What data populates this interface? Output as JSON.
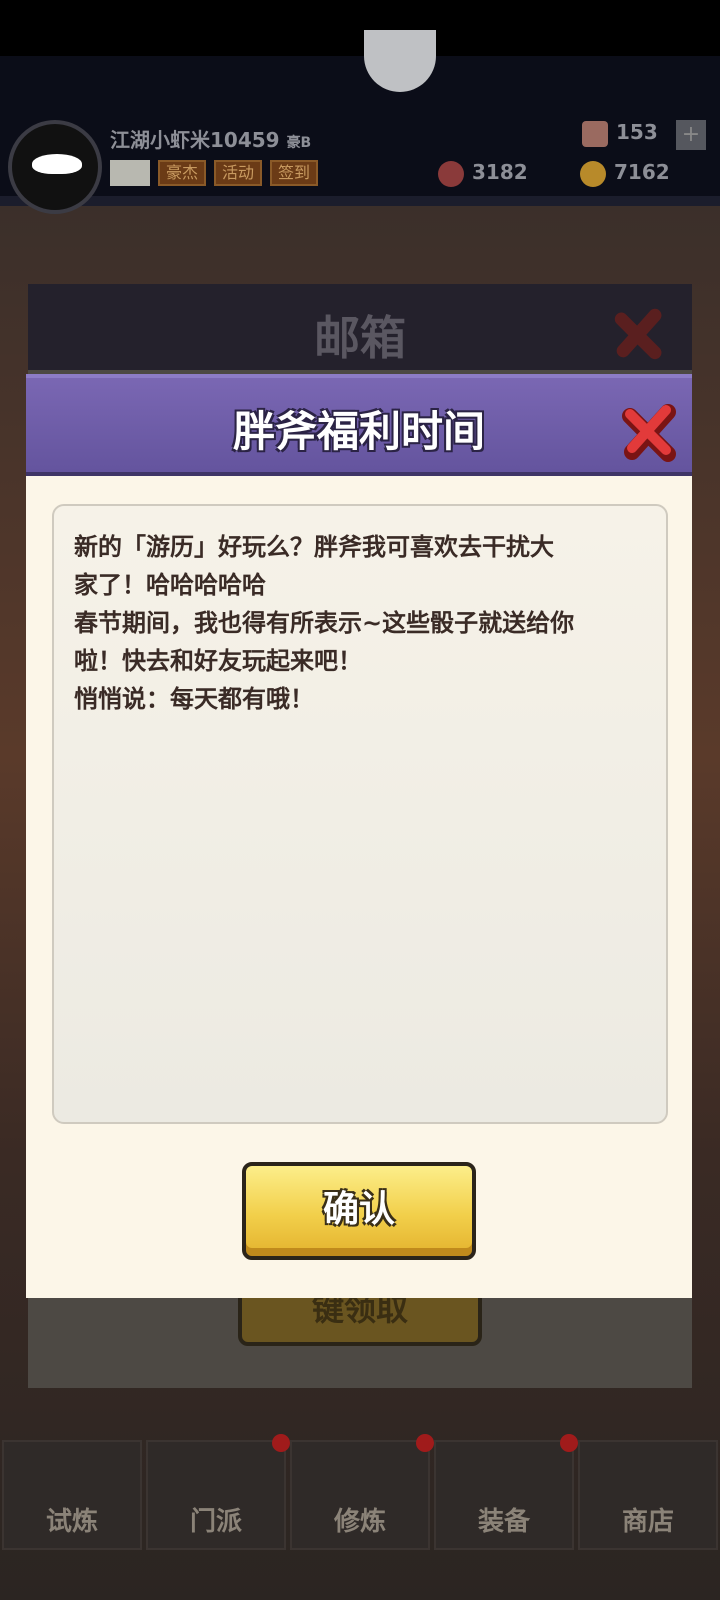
{
  "game_header": {
    "username": "江湖小虾米10459",
    "user_badge": "豪B",
    "tags": [
      "豪杰",
      "活动",
      "签到"
    ],
    "gems": "153",
    "tokens": "3182",
    "coins": "7162"
  },
  "mail_panel": {
    "title": "邮箱",
    "claim_label": "键领取"
  },
  "dialog": {
    "title": "胖斧福利时间",
    "message_lines": [
      "新的「游历」好玩么？胖斧我可喜欢去干扰大",
      "家了！哈哈哈哈哈",
      "春节期间，我也得有所表示~这些骰子就送给你",
      "啦！快去和好友玩起来吧！",
      "悄悄说：每天都有哦！"
    ],
    "confirm_label": "确认"
  },
  "bottom_nav": {
    "items": [
      {
        "label": "试炼"
      },
      {
        "label": "门派"
      },
      {
        "label": "修炼"
      },
      {
        "label": "装备"
      },
      {
        "label": "商店"
      }
    ]
  },
  "colors": {
    "dialog_header": "#6a5aa8",
    "confirm_button": "#f2cf4a",
    "close_icon": "#e23a3a",
    "message_text": "#3a2b26"
  },
  "icons": [
    "close-icon",
    "mail-icon",
    "gem-icon",
    "token-icon",
    "coin-icon"
  ]
}
